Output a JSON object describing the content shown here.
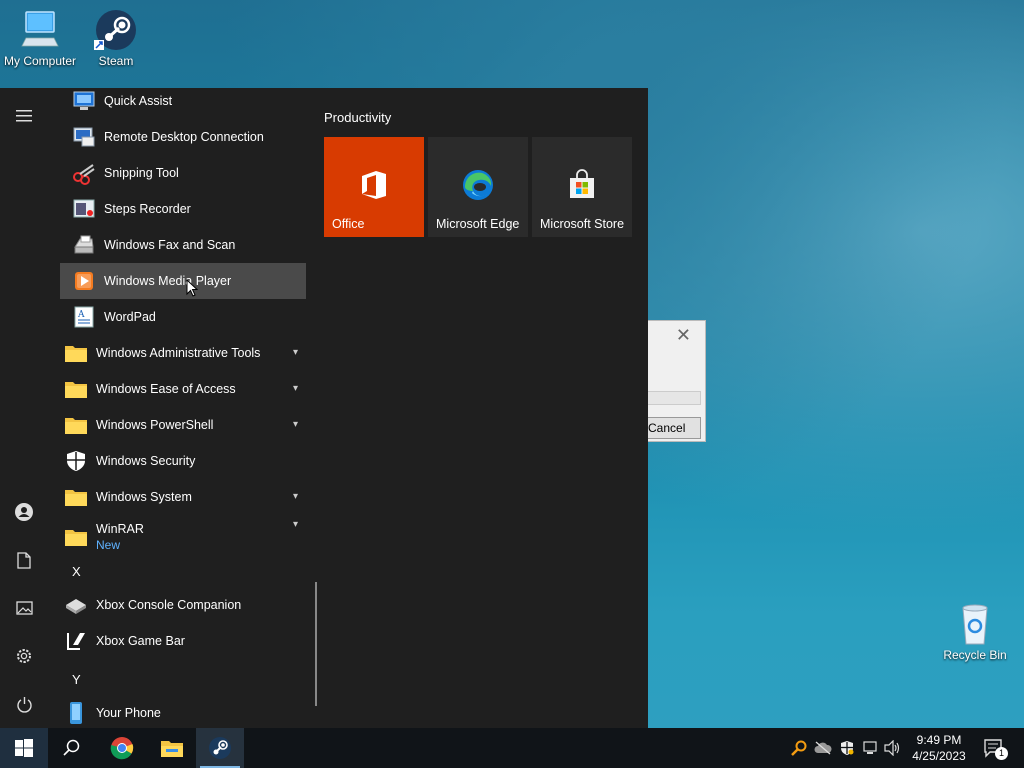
{
  "desktop": {
    "icons": [
      {
        "label": "My Computer"
      },
      {
        "label": "Steam"
      },
      {
        "label": "Recycle Bin"
      }
    ]
  },
  "dialog": {
    "cancel_label": "Cancel"
  },
  "start_menu": {
    "apps": [
      {
        "label": "Quick Assist"
      },
      {
        "label": "Remote Desktop Connection"
      },
      {
        "label": "Snipping Tool"
      },
      {
        "label": "Steps Recorder"
      },
      {
        "label": "Windows Fax and Scan"
      },
      {
        "label": "Windows Media Player"
      },
      {
        "label": "WordPad"
      },
      {
        "label": "Windows Administrative Tools"
      },
      {
        "label": "Windows Ease of Access"
      },
      {
        "label": "Windows PowerShell"
      },
      {
        "label": "Windows Security"
      },
      {
        "label": "Windows System"
      },
      {
        "label": "WinRAR",
        "badge": "New"
      },
      {
        "label": "Xbox Console Companion"
      },
      {
        "label": "Xbox Game Bar"
      },
      {
        "label": "Your Phone"
      }
    ],
    "letters": [
      "X",
      "Y"
    ],
    "group_title": "Productivity",
    "tiles": [
      {
        "label": "Office",
        "color": "#d83b01"
      },
      {
        "label": "Microsoft Edge",
        "color": "#2b2b2b"
      },
      {
        "label": "Microsoft Store",
        "color": "#2b2b2b"
      }
    ]
  },
  "taskbar": {
    "time": "9:49 PM",
    "date": "4/25/2023",
    "notification_count": "1"
  }
}
